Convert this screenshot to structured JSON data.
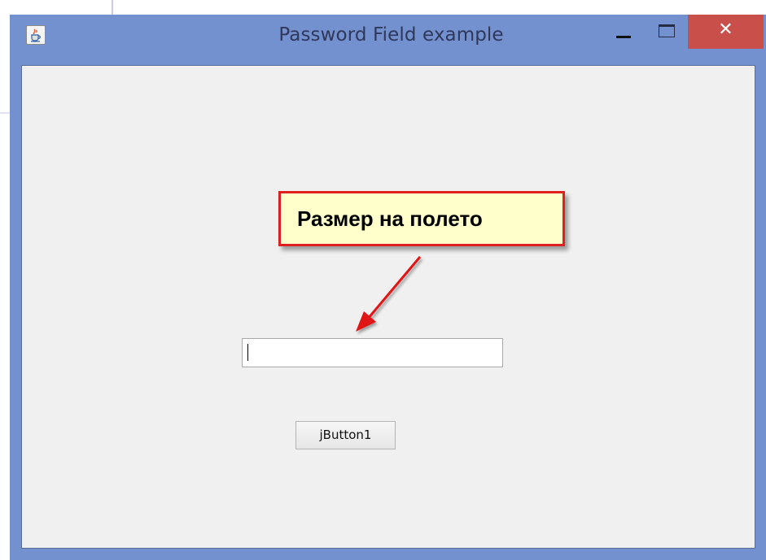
{
  "window": {
    "title": "Password Field example",
    "icon": "java-cup-icon",
    "controls": {
      "minimize": "minimize-icon",
      "maximize": "maximize-icon",
      "close": "✕"
    },
    "frame_color": "#7390cf",
    "close_color": "#c9504a"
  },
  "annotation": {
    "text": "Размер на полето",
    "border_color": "#e02020",
    "fill_color": "#ffffcc",
    "arrow_icon": "red-arrow-icon"
  },
  "form": {
    "password_field_value": "",
    "button_label": "jButton1"
  }
}
